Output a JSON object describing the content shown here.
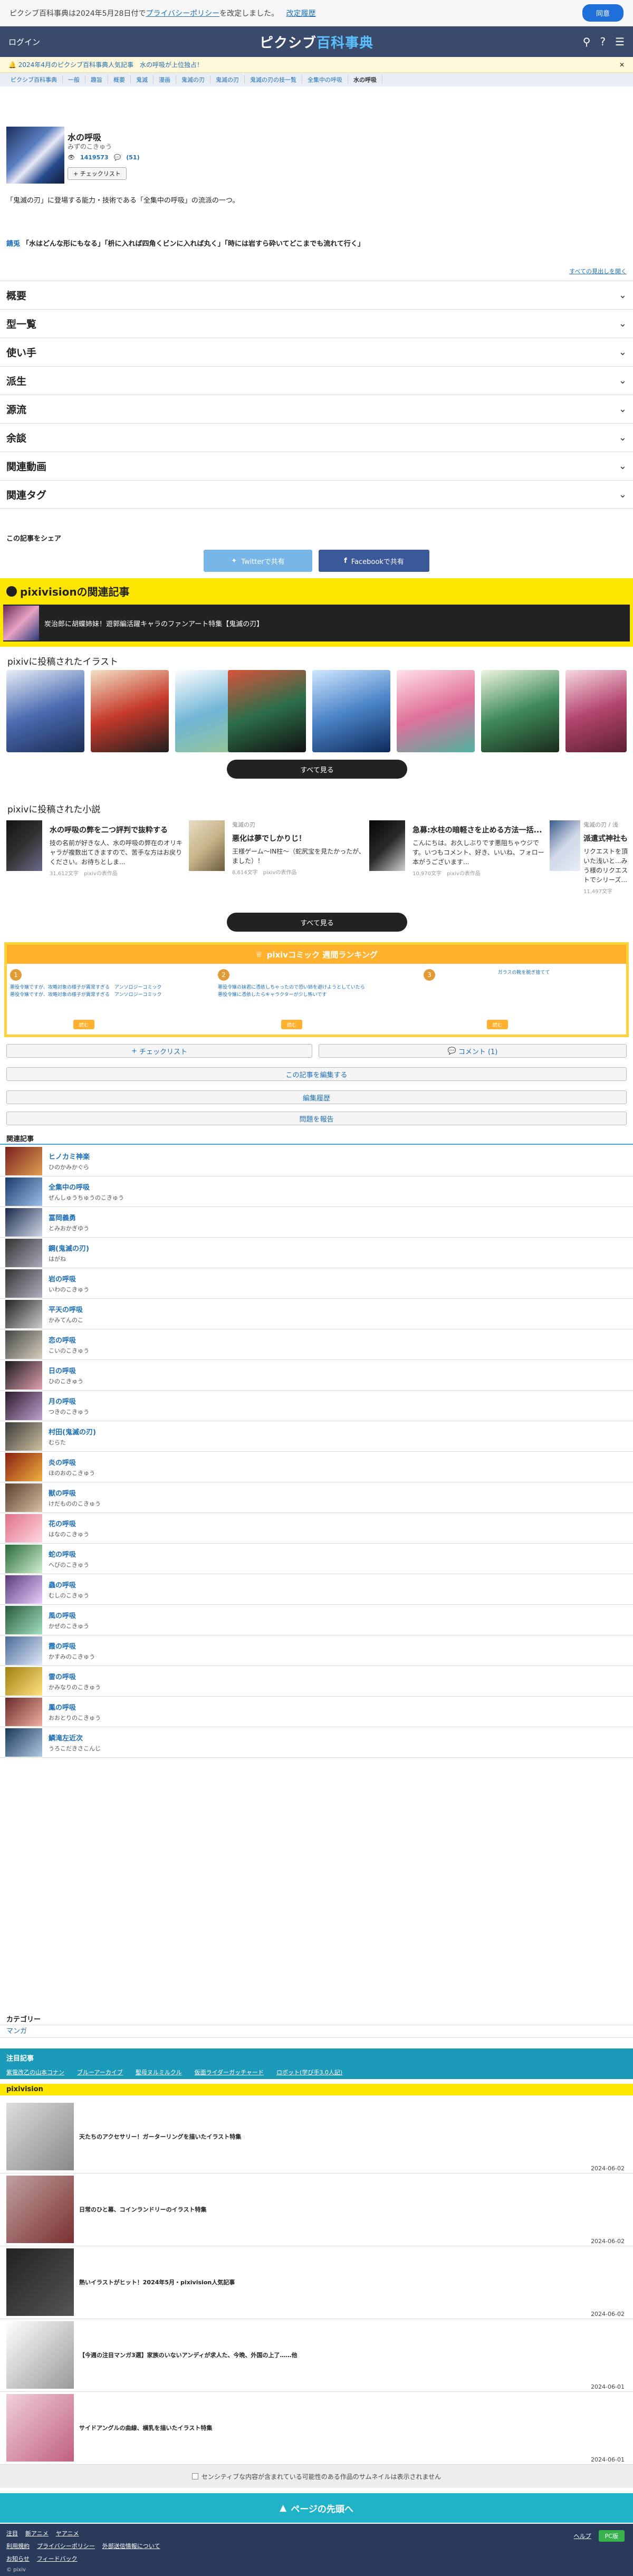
{
  "privacy": {
    "text": "ピクシブ百科事典は2024年5月28日付で",
    "link": "プライバシーポリシー",
    "text2": "を改定しました。",
    "link2": "改定履歴",
    "button": "同意"
  },
  "header": {
    "login": "ログイン",
    "logo_main": "ピクシブ",
    "logo_sub": "百科事典"
  },
  "notice": {
    "text": "2024年4月のピクシブ百科事典人気記事　水の呼吸が上位独占！"
  },
  "nav": [
    "ピクシブ百科事典",
    "一般",
    "趣旨",
    "概要",
    "鬼滅",
    "漫画",
    "鬼滅の刃",
    "鬼滅の刃",
    "鬼滅の刃の技一覧",
    "全集中の呼吸",
    "水の呼吸"
  ],
  "article": {
    "title": "水の呼吸",
    "yomi": "みずのこきゅう",
    "views": "1419573",
    "comments": "(51)",
    "check": "チェックリスト",
    "summary": "「鬼滅の刃」に登場する能力・技術である「全集中の呼吸」の流派の一つ。"
  },
  "quote": {
    "label": "錆兎",
    "text": "「水はどんな形にもなる」「枡に入れば四角くビンに入れば丸く」「時には岩すら砕いてどこまでも流れて行く」"
  },
  "more_link": "すべての見出しを開く",
  "sections": [
    "概要",
    "型一覧",
    "使い手",
    "派生",
    "源流",
    "余談",
    "関連動画",
    "関連タグ"
  ],
  "share": {
    "label": "この記事をシェア",
    "twitter": "Twitterで共有",
    "facebook": "Facebookで共有"
  },
  "pixivision": {
    "heading": "pixivisionの関連記事",
    "banner": "炭治郎に胡蝶姉妹！遊郭編活躍キャラのファンアート特集【鬼滅の刃】"
  },
  "illustrations": {
    "heading": "pixivに投稿されたイラスト",
    "see_all": "すべて見る"
  },
  "novels": {
    "heading": "pixivに投稿された小説",
    "see_all": "すべて見る",
    "items": [
      {
        "meta": "",
        "title": "水の呼吸の弊を二つ評判で抜粋する",
        "desc": "技の名前が好きな人、水の呼吸の弊在のオリキャラが複数出てきますので、苦手な方はお戻りください。お待ちとしま...",
        "foot": "31,612文字　pixivの表作品"
      },
      {
        "meta": "鬼滅の刃",
        "title": "悪化は夢でしかりじ！",
        "desc": "王様ゲーム〜IN柱〜（蛇尻宝を見たかったが、ました）！",
        "foot": "8,614文字　pixivの表作品"
      },
      {
        "meta": "",
        "title": "急募:水柱の暗軽さを止める方法一括...",
        "desc": "こんにちは。お久しぶりです悪阻ちゃウジです。いつもコメント、好き、いいね、フォロー本がうございます...",
        "foot": "10,970文字　pixivの表作品"
      },
      {
        "meta": "鬼滅の刃 / 浅",
        "title": "派遣式神社も",
        "desc": "リクエストを頂いた浅いと...みう様のリクエストでシリーズ...",
        "foot": "11,497文字"
      }
    ]
  },
  "ranking": {
    "title": "pixivコミック 週間ランキング",
    "items": [
      {
        "num": "1",
        "title": "悪役令嬢ですが、攻略対象の様子が異常すぎる　アンソロジーコミック",
        "sub": "悪役令嬢ですが、攻略対象の様子が異常すぎる　アンソロジーコミック",
        "read": "読む"
      },
      {
        "num": "2",
        "title": "悪役令嬢の妹君に憑依しちゃったので恐い姉を避けようとしていたら",
        "sub": "悪役令嬢に憑依したらキャラクターが少し怖いです",
        "read": "読む"
      },
      {
        "num": "3",
        "title": "ガラスの靴を脱ぎ捨てて",
        "sub": "",
        "read": "読む"
      }
    ]
  },
  "actions": {
    "checklist": "チェックリスト",
    "comment": "コメント (1)",
    "edit": "この記事を編集する",
    "history": "編集履歴",
    "report": "問題を報告"
  },
  "related_heading": "関連記事",
  "related": [
    {
      "name": "ヒノカミ神楽",
      "yomi": "ひのかみかぐら"
    },
    {
      "name": "全集中の呼吸",
      "yomi": "ぜんしゅうちゅうのこきゅう"
    },
    {
      "name": "冨岡義勇",
      "yomi": "とみおかぎゆう"
    },
    {
      "name": "鋼(鬼滅の刃)",
      "yomi": "はがね"
    },
    {
      "name": "岩の呼吸",
      "yomi": "いわのこきゅう"
    },
    {
      "name": "平天の呼吸",
      "yomi": "かみてんのこ"
    },
    {
      "name": "恋の呼吸",
      "yomi": "こいのこきゅう"
    },
    {
      "name": "日の呼吸",
      "yomi": "ひのこきゅう"
    },
    {
      "name": "月の呼吸",
      "yomi": "つきのこきゅう"
    },
    {
      "name": "村田(鬼滅の刃)",
      "yomi": "むらた"
    },
    {
      "name": "炎の呼吸",
      "yomi": "ほのおのこきゅう"
    },
    {
      "name": "獣の呼吸",
      "yomi": "けだもののこきゅう"
    },
    {
      "name": "花の呼吸",
      "yomi": "はなのこきゅう"
    },
    {
      "name": "蛇の呼吸",
      "yomi": "へびのこきゅう"
    },
    {
      "name": "蟲の呼吸",
      "yomi": "むしのこきゅう"
    },
    {
      "name": "風の呼吸",
      "yomi": "かぜのこきゅう"
    },
    {
      "name": "霞の呼吸",
      "yomi": "かすみのこきゅう"
    },
    {
      "name": "雷の呼吸",
      "yomi": "かみなりのこきゅう"
    },
    {
      "name": "鳳の呼吸",
      "yomi": "おおとりのこきゅう"
    },
    {
      "name": "鱗滝左近次",
      "yomi": "うろこだきさこんじ"
    }
  ],
  "category": {
    "heading": "カテゴリー",
    "value": "マンガ"
  },
  "trend": {
    "heading": "注目記事",
    "items": [
      "紫電改乙の山本コナン",
      "ブルーアーカイブ",
      "聖母ヌルミルクル",
      "仮面ライダーガッチャード",
      "ロボット(学び手3.0人記)"
    ]
  },
  "pixivision_list": {
    "heading": "pixivision",
    "items": [
      {
        "title": "天たちのアクセサリー！ガーターリングを描いたイラスト特集",
        "date": "2024-06-02"
      },
      {
        "title": "日常のひと幕、コインランドリーのイラスト特集",
        "date": "2024-06-02"
      },
      {
        "title": "熱いイラストがヒット！2024年5月・pixivision人気記事",
        "date": "2024-06-02"
      },
      {
        "title": "【今週の注目マンガ3選】家族のいないアンディが求人た、今晩、外国の上了……他",
        "date": "2024-06-01"
      },
      {
        "title": "サイドアングルの曲線、横乳を描いたイラスト特集",
        "date": "2024-06-01"
      }
    ]
  },
  "sensitive": "センシティブな内容が含まれている可能性のある作品のサムネイルは表示されません",
  "totop": "ページの先頭へ",
  "footer": {
    "row1": [
      "注目",
      "新アニメ",
      "ヤアニメ"
    ],
    "row2": [
      "利用規約",
      "プライバシーポリシー",
      "外部送信情報について"
    ],
    "row3": [
      "お知らせ",
      "フィードバック"
    ],
    "copyright": "© pixiv",
    "help": "ヘルプ",
    "pc": "PC版"
  },
  "colors": {
    "accent": "#1f6fb5",
    "header": "#3a4a6a",
    "pixivision": "#ffe600",
    "ranking": "#ffb12d",
    "totop": "#1fb2c8"
  }
}
